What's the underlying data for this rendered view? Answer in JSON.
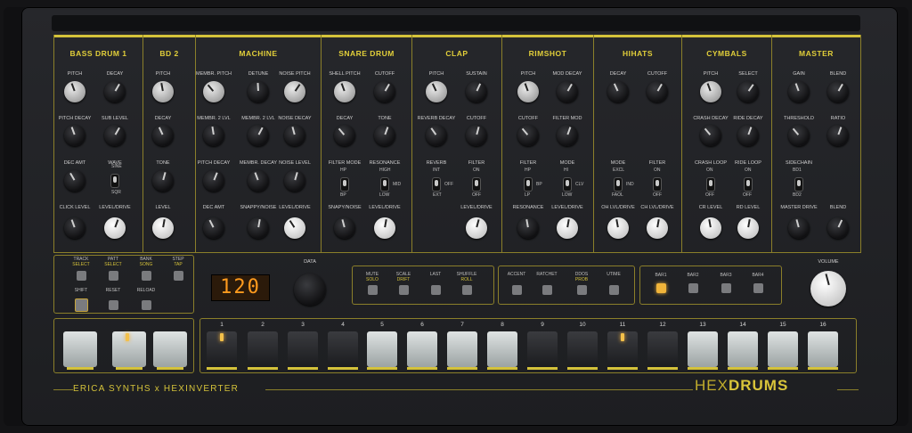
{
  "sections": [
    {
      "title": "BASS DRUM 1"
    },
    {
      "title": "BD 2"
    },
    {
      "title": "MACHINE"
    },
    {
      "title": "SNARE DRUM"
    },
    {
      "title": "CLAP"
    },
    {
      "title": "RIMSHOT"
    },
    {
      "title": "HIHATS"
    },
    {
      "title": "CYMBALS"
    },
    {
      "title": "MASTER"
    }
  ],
  "knob_labels": {
    "bd1": [
      "PITCH",
      "DECAY",
      "PITCH DECAY",
      "SUB LEVEL",
      "DEC AMT",
      "WAVE",
      "CLICK LEVEL",
      "LEVEL/DRIVE"
    ],
    "bd2": [
      "PITCH",
      "DECAY",
      "TONE",
      "LEVEL"
    ],
    "machine": [
      "MEMBR. PITCH",
      "DETUNE",
      "NOISE PITCH",
      "MEMBR. 2 LVL",
      "MEMBR. 2 LVL",
      "NOISE DECAY",
      "PITCH DECAY",
      "MEMBR. DECAY",
      "NOISE LEVEL",
      "DEC AMT",
      "SNAPPY/NOISE",
      "LEVEL/DRIVE"
    ],
    "snare": [
      "SHELL PITCH",
      "CUTOFF",
      "DECAY",
      "TONE",
      "FILTER MODE",
      "RESONANCE",
      "SNAPY/NOISE",
      "LEVEL/DRIVE"
    ],
    "clap": [
      "PITCH",
      "SUSTAIN",
      "REVERB DECAY",
      "CUTOFF",
      "REVERB",
      "FILTER",
      "LEVEL/DRIVE"
    ],
    "rimshot": [
      "PITCH",
      "MOD DECAY",
      "CUTOFF",
      "FILTER MOD",
      "FILTER",
      "MODE",
      "RESONANCE",
      "LEVEL/DRIVE"
    ],
    "hihats": [
      "DECAY",
      "CUTOFF",
      "MODE",
      "FILTER",
      "OH LVL/DRIVE",
      "CH LVL/DRIVE"
    ],
    "cymbals": [
      "PITCH",
      "SELECT",
      "CRASH DECAY",
      "RIDE DECAY",
      "CRASH LOOP",
      "RIDE LOOP",
      "CR LEVEL",
      "RD LEVEL"
    ],
    "master": [
      "GAIN",
      "BLEND",
      "THRESHOLD",
      "RATIO",
      "SIDECHAIN",
      "MASTER DRIVE",
      "BLEND"
    ]
  },
  "toggle_labels": {
    "bd1_wave": [
      "SINE",
      "SQR"
    ],
    "snare_mode": [
      "HP",
      "BP",
      "HIGH",
      "MID",
      "LOW"
    ],
    "clap_reverb": [
      "INT",
      "OFF",
      "EXT"
    ],
    "clap_filter": [
      "ON",
      "OFF"
    ],
    "rim_filter": [
      "HP",
      "BP",
      "LP"
    ],
    "rim_mode": [
      "HI",
      "CLV",
      "LOW"
    ],
    "hh_mode": [
      "EXCL",
      "IND",
      "FAOL"
    ],
    "hh_filter": [
      "ON",
      "OFF"
    ],
    "cy_crash": [
      "ON",
      "OFF"
    ],
    "cy_ride": [
      "ON",
      "OFF"
    ],
    "master_sc": [
      "BD1",
      "BD2"
    ]
  },
  "left_pads": [
    {
      "line1": "TRACK",
      "line2": "SELECT"
    },
    {
      "line1": "PATT",
      "line2": "SELECT"
    },
    {
      "line1": "BANK",
      "line2": "SONG"
    },
    {
      "line1": "STEP",
      "line2": "TAP"
    },
    {
      "line1": "SHIFT",
      "line2": ""
    },
    {
      "line1": "RESET",
      "line2": ""
    },
    {
      "line1": "RELOAD",
      "line2": ""
    }
  ],
  "display": {
    "tempo": "120"
  },
  "data_label": "DATA",
  "mute_group": [
    {
      "line1": "MUTE",
      "line2": "SOLO"
    },
    {
      "line1": "SCALE",
      "line2": "DRIFT"
    },
    {
      "line1": "LAST",
      "line2": ""
    },
    {
      "line1": "SHUFFLE",
      "line2": "ROLL"
    }
  ],
  "accent_group": [
    {
      "line1": "ACCENT",
      "line2": ""
    },
    {
      "line1": "RATCHET",
      "line2": ""
    },
    {
      "line1": "DDOS",
      "line2": "PROB"
    },
    {
      "line1": "UTIME",
      "line2": ""
    }
  ],
  "bars": [
    {
      "label": "BAR1"
    },
    {
      "label": "BAR2"
    },
    {
      "label": "BAR3"
    },
    {
      "label": "BAR4"
    }
  ],
  "volume_label": "VOLUME",
  "steps": [
    "1",
    "2",
    "3",
    "4",
    "5",
    "6",
    "7",
    "8",
    "9",
    "10",
    "11",
    "12",
    "13",
    "14",
    "15",
    "16"
  ],
  "footer": {
    "left": "ERICA SYNTHS x HEXINVERTER",
    "right_a": "HEX",
    "right_b": "DRUMS"
  }
}
